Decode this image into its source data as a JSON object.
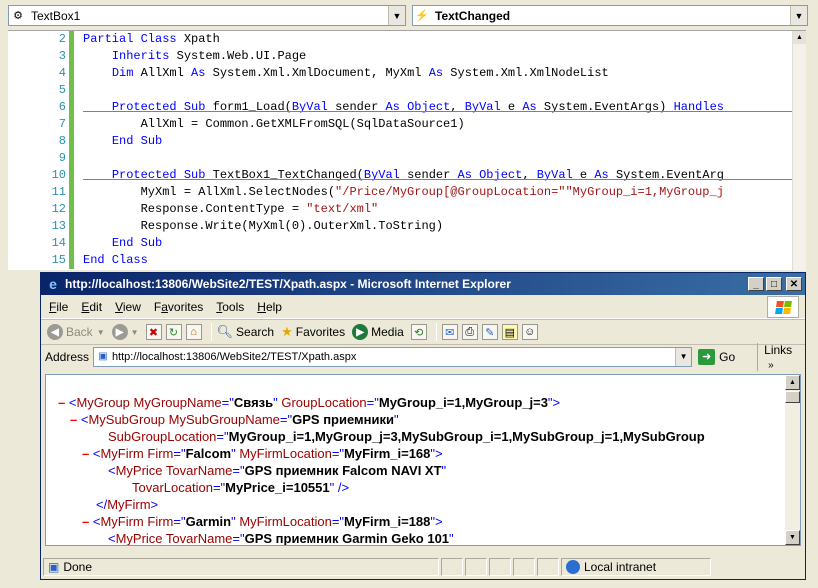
{
  "editor": {
    "object_combo": "TextBox1",
    "event_combo": "TextChanged",
    "lines": [
      {
        "num": "2",
        "change": "green",
        "segments": [
          [
            "kw",
            "Partial Class"
          ],
          [
            "t",
            " Xpath"
          ]
        ]
      },
      {
        "num": "3",
        "change": "green",
        "segments": [
          [
            "t",
            "    "
          ],
          [
            "kw",
            "Inherits"
          ],
          [
            "t",
            " System.Web.UI.Page"
          ]
        ]
      },
      {
        "num": "4",
        "change": "green",
        "segments": [
          [
            "t",
            "    "
          ],
          [
            "kw",
            "Dim"
          ],
          [
            "t",
            " AllXml "
          ],
          [
            "kw",
            "As"
          ],
          [
            "t",
            " System.Xml.XmlDocument, MyXml "
          ],
          [
            "kw",
            "As"
          ],
          [
            "t",
            " System.Xml.XmlNodeList"
          ]
        ]
      },
      {
        "num": "5",
        "change": "green",
        "segments": []
      },
      {
        "num": "6",
        "change": "green",
        "segments": [
          [
            "t",
            "    "
          ],
          [
            "kw",
            "Protected Sub"
          ],
          [
            "t",
            " form1_Load("
          ],
          [
            "kw",
            "ByVal"
          ],
          [
            "t",
            " sender "
          ],
          [
            "kw",
            "As Object"
          ],
          [
            "t",
            ", "
          ],
          [
            "kw",
            "ByVal"
          ],
          [
            "t",
            " e "
          ],
          [
            "kw",
            "As"
          ],
          [
            "t",
            " System.EventArgs) "
          ],
          [
            "kw",
            "Handles"
          ]
        ]
      },
      {
        "num": "7",
        "change": "green",
        "segments": [
          [
            "t",
            "        AllXml = Common.GetXMLFromSQL(SqlDataSource1)"
          ]
        ]
      },
      {
        "num": "8",
        "change": "green",
        "segments": [
          [
            "t",
            "    "
          ],
          [
            "kw",
            "End Sub"
          ]
        ]
      },
      {
        "num": "9",
        "change": "green",
        "segments": []
      },
      {
        "num": "10",
        "change": "green",
        "segments": [
          [
            "t",
            "    "
          ],
          [
            "kw",
            "Protected Sub"
          ],
          [
            "t",
            " TextBox1_TextChanged("
          ],
          [
            "kw",
            "ByVal"
          ],
          [
            "t",
            " sender "
          ],
          [
            "kw",
            "As Object"
          ],
          [
            "t",
            ", "
          ],
          [
            "kw",
            "ByVal"
          ],
          [
            "t",
            " e "
          ],
          [
            "kw",
            "As"
          ],
          [
            "t",
            " System.EventArg"
          ]
        ]
      },
      {
        "num": "11",
        "change": "green",
        "segments": [
          [
            "t",
            "        MyXml = AllXml.SelectNodes("
          ],
          [
            "str",
            "\"/Price/MyGroup[@GroupLocation=\"\"MyGroup_i=1,MyGroup_j"
          ]
        ]
      },
      {
        "num": "12",
        "change": "green",
        "segments": [
          [
            "t",
            "        Response.ContentType = "
          ],
          [
            "str",
            "\"text/xml\""
          ]
        ]
      },
      {
        "num": "13",
        "change": "green",
        "segments": [
          [
            "t",
            "        Response.Write(MyXml(0).OuterXml.ToString)"
          ]
        ]
      },
      {
        "num": "14",
        "change": "green",
        "segments": [
          [
            "t",
            "    "
          ],
          [
            "kw",
            "End Sub"
          ]
        ]
      },
      {
        "num": "15",
        "change": "green",
        "segments": [
          [
            "kw",
            "End Class"
          ]
        ]
      }
    ]
  },
  "ie": {
    "title": "http://localhost:13806/WebSite2/TEST/Xpath.aspx - Microsoft Internet Explorer",
    "menu": [
      {
        "pre": "",
        "u": "F",
        "post": "ile"
      },
      {
        "pre": "",
        "u": "E",
        "post": "dit"
      },
      {
        "pre": "",
        "u": "V",
        "post": "iew"
      },
      {
        "pre": "F",
        "u": "a",
        "post": "vorites"
      },
      {
        "pre": "",
        "u": "T",
        "post": "ools"
      },
      {
        "pre": "",
        "u": "H",
        "post": "elp"
      }
    ],
    "toolbar": {
      "back": "Back",
      "search": "Search",
      "favorites": "Favorites",
      "media": "Media"
    },
    "address_label": "Address",
    "address_url": "http://localhost:13806/WebSite2/TEST/Xpath.aspx",
    "go_label": "Go",
    "links_label": "Links",
    "status": {
      "done": "Done",
      "zone": "Local intranet"
    },
    "xml": [
      {
        "indent": 0,
        "minus": true,
        "parts": [
          [
            "br",
            "<"
          ],
          [
            "tag",
            "MyGroup"
          ],
          [
            "an",
            " MyGroupName"
          ],
          [
            "br",
            "=\""
          ],
          [
            "av",
            "Связь"
          ],
          [
            "br",
            "\""
          ],
          [
            "an",
            " GroupLocation"
          ],
          [
            "br",
            "=\""
          ],
          [
            "av",
            "MyGroup_i=1,MyGroup_j=3"
          ],
          [
            "br",
            "\">"
          ]
        ]
      },
      {
        "indent": 1,
        "minus": true,
        "parts": [
          [
            "br",
            "<"
          ],
          [
            "tag",
            "MySubGroup"
          ],
          [
            "an",
            " MySubGroupName"
          ],
          [
            "br",
            "=\""
          ],
          [
            "av",
            "GPS приемники"
          ],
          [
            "br",
            "\""
          ]
        ]
      },
      {
        "indent": 1,
        "cont": true,
        "parts": [
          [
            "an",
            "SubGroupLocation"
          ],
          [
            "br",
            "=\""
          ],
          [
            "av",
            "MyGroup_i=1,MyGroup_j=3,MySubGroup_i=1,MySubGroup_j=1,MySubGroup"
          ]
        ]
      },
      {
        "indent": 2,
        "minus": true,
        "parts": [
          [
            "br",
            "<"
          ],
          [
            "tag",
            "MyFirm"
          ],
          [
            "an",
            " Firm"
          ],
          [
            "br",
            "=\""
          ],
          [
            "av",
            "Falcom"
          ],
          [
            "br",
            "\""
          ],
          [
            "an",
            " MyFirmLocation"
          ],
          [
            "br",
            "=\""
          ],
          [
            "av",
            "MyFirm_i=168"
          ],
          [
            "br",
            "\">"
          ]
        ]
      },
      {
        "indent": 3,
        "parts": [
          [
            "br",
            "<"
          ],
          [
            "tag",
            "MyPrice"
          ],
          [
            "an",
            " TovarName"
          ],
          [
            "br",
            "=\""
          ],
          [
            "av",
            "GPS приемник Falcom NAVI XT"
          ],
          [
            "br",
            "\""
          ]
        ]
      },
      {
        "indent": 3,
        "cont": true,
        "parts": [
          [
            "an",
            "TovarLocation"
          ],
          [
            "br",
            "=\""
          ],
          [
            "av",
            "MyPrice_i=10551"
          ],
          [
            "br",
            "\" />"
          ]
        ]
      },
      {
        "indent": 2,
        "parts": [
          [
            "br",
            "</"
          ],
          [
            "tag",
            "MyFirm"
          ],
          [
            "br",
            ">"
          ]
        ]
      },
      {
        "indent": 2,
        "minus": true,
        "parts": [
          [
            "br",
            "<"
          ],
          [
            "tag",
            "MyFirm"
          ],
          [
            "an",
            " Firm"
          ],
          [
            "br",
            "=\""
          ],
          [
            "av",
            "Garmin"
          ],
          [
            "br",
            "\""
          ],
          [
            "an",
            " MyFirmLocation"
          ],
          [
            "br",
            "=\""
          ],
          [
            "av",
            "MyFirm_i=188"
          ],
          [
            "br",
            "\">"
          ]
        ]
      },
      {
        "indent": 3,
        "parts": [
          [
            "br",
            "<"
          ],
          [
            "tag",
            "MyPrice"
          ],
          [
            "an",
            " TovarName"
          ],
          [
            "br",
            "=\""
          ],
          [
            "av",
            "GPS приемник Garmin Geko 101"
          ],
          [
            "br",
            "\""
          ]
        ]
      }
    ]
  }
}
